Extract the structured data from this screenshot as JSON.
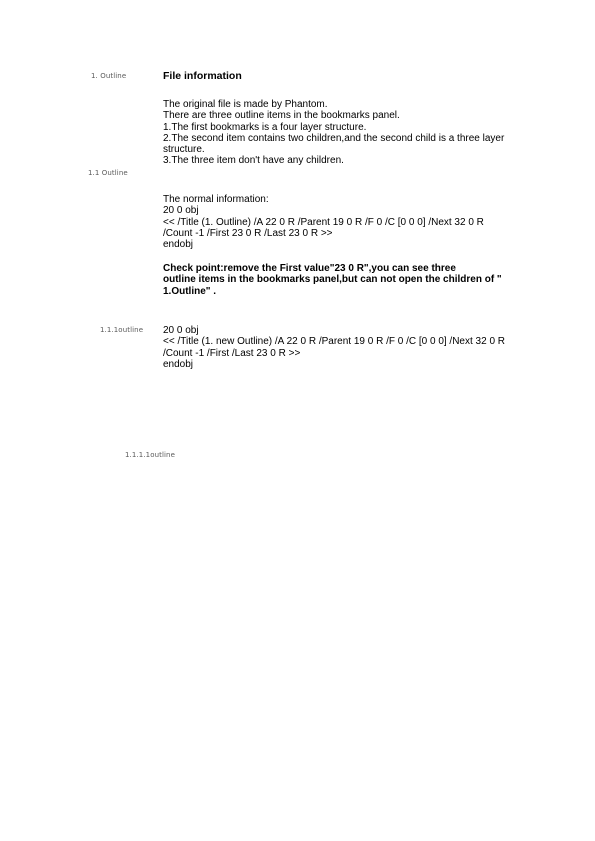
{
  "margin_labels": {
    "outline_1": "1.  Outline",
    "outline_1_1": "1.1 Outline",
    "outline_1_1_1": "1.1.1outline",
    "outline_1_1_1_1": "1.1.1.1outline"
  },
  "heading": "File information",
  "intro_lines": [
    "The original file is made by Phantom.",
    "There are three outline items in the bookmarks panel.",
    "1.The first bookmarks is a four layer structure.",
    "2.The second item contains two children,and the second child is a three layer",
    "structure.",
    "3.The three item don't have any children."
  ],
  "normal_info": {
    "label": "The normal information:",
    "lines": [
      "20 0 obj",
      "<< /Title (1. Outline) /A 22 0 R /Parent 19 0 R /F 0 /C [0 0 0] /Next 32 0 R",
      "/Count -1 /First 23 0 R /Last 23 0 R >>",
      "endobj"
    ]
  },
  "check_point_lines": [
    "Check point:remove the First value\"23 0 R\",you can see three",
    "outline items in the bookmarks panel,but can not open the children of \"",
    "1.Outline\" ."
  ],
  "modified_lines": [
    "20 0 obj",
    "<< /Title (1. new Outline) /A 22 0 R /Parent 19 0 R /F 0 /C [0 0 0] /Next 32 0 R",
    "/Count -1 /First /Last 23 0 R >>",
    "endobj"
  ]
}
